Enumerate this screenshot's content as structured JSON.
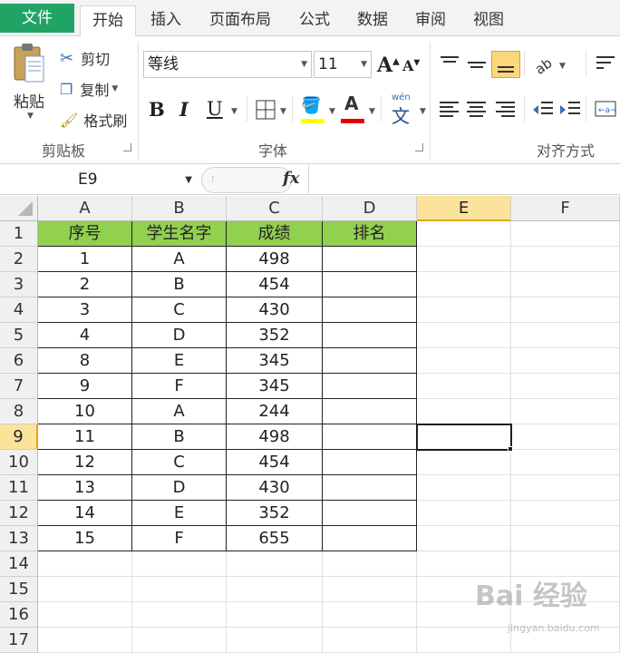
{
  "tabs": [
    {
      "label": "文件",
      "key": "file"
    },
    {
      "label": "开始",
      "key": "home"
    },
    {
      "label": "插入",
      "key": "insert"
    },
    {
      "label": "页面布局",
      "key": "layout"
    },
    {
      "label": "公式",
      "key": "formulas"
    },
    {
      "label": "数据",
      "key": "data"
    },
    {
      "label": "审阅",
      "key": "review"
    },
    {
      "label": "视图",
      "key": "view"
    }
  ],
  "clipboard": {
    "paste_label": "粘贴",
    "cut_label": "剪切",
    "copy_label": "复制",
    "format_painter_label": "格式刷",
    "group_label": "剪贴板"
  },
  "font": {
    "font_name": "等线",
    "font_size": "11",
    "group_label": "字体",
    "bold": "B",
    "italic": "I",
    "underline": "U",
    "font_color": "#e00000",
    "fill_color": "#ffff00"
  },
  "alignment": {
    "group_label": "对齐方式"
  },
  "formula_bar": {
    "name_box": "E9",
    "fx": "fx",
    "content": ""
  },
  "columns": [
    "A",
    "B",
    "C",
    "D",
    "E",
    "F"
  ],
  "rows": [
    "1",
    "2",
    "3",
    "4",
    "5",
    "6",
    "7",
    "8",
    "9",
    "10",
    "11",
    "12",
    "13",
    "14",
    "15",
    "16",
    "17"
  ],
  "selected_cell": "E9",
  "table": {
    "headers": [
      "序号",
      "学生名字",
      "成绩",
      "排名"
    ],
    "header_color": "#92d050",
    "rows": [
      [
        "1",
        "A",
        "498",
        ""
      ],
      [
        "2",
        "B",
        "454",
        ""
      ],
      [
        "3",
        "C",
        "430",
        ""
      ],
      [
        "4",
        "D",
        "352",
        ""
      ],
      [
        "8",
        "E",
        "345",
        ""
      ],
      [
        "9",
        "F",
        "345",
        ""
      ],
      [
        "10",
        "A",
        "244",
        ""
      ],
      [
        "11",
        "B",
        "498",
        ""
      ],
      [
        "12",
        "C",
        "454",
        ""
      ],
      [
        "13",
        "D",
        "430",
        ""
      ],
      [
        "14",
        "E",
        "352",
        ""
      ],
      [
        "15",
        "F",
        "655",
        ""
      ]
    ]
  },
  "watermark": {
    "main": "Bai 经验",
    "sub": "jingyan.baidu.com"
  }
}
